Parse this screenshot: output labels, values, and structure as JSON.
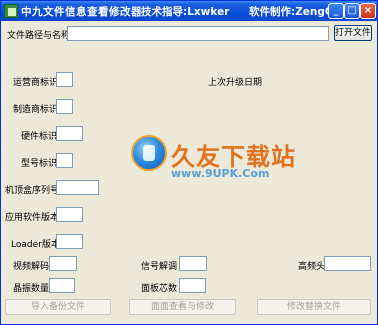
{
  "titlebar": {
    "app_title": "中九文件信息查看修改器",
    "guide": "技术指导:Lxwker",
    "author": "软件制作:ZengChuan",
    "minimize": "_",
    "maximize": "□",
    "close": "×"
  },
  "file": {
    "path_label": "文件路径与名称",
    "path_value": "",
    "open_button": "打开文件"
  },
  "fields": {
    "operator_id": "运营商标识",
    "manufacturer_id": "制造商标识",
    "hardware_id": "硬件标识",
    "model_id": "型号标识",
    "stb_serial": "机顶盒序列号",
    "app_version": "应用软件版本",
    "loader_version": "Loader版本",
    "last_upgrade_date": "上次升级日期",
    "video_decode": "视频解码",
    "signal_demod": "信号解调",
    "tuner": "高频头",
    "flash_size": "晶振数量",
    "panel_chip": "面板芯数"
  },
  "actions": {
    "import_backup": "导入备份文件",
    "view_modify": "面面查看与修改",
    "modify_save": "修改替换文件"
  },
  "watermark": {
    "title": "久友下载站",
    "url": "www.9UPK.Com"
  }
}
